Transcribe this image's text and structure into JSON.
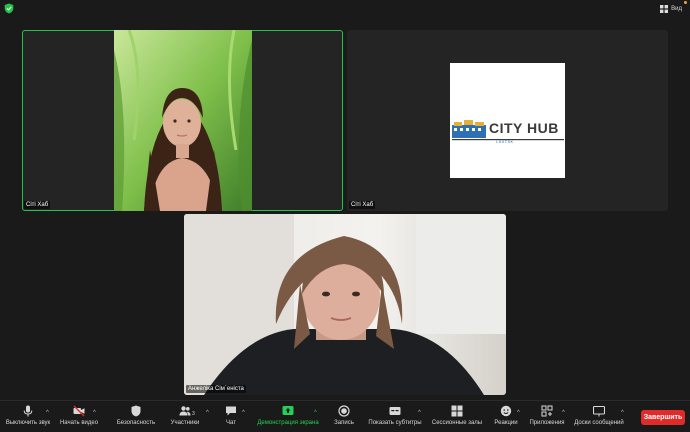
{
  "topbar": {
    "view_label": "Вид"
  },
  "participants": [
    {
      "name": "Сіті Хаб",
      "active": true
    },
    {
      "name": "Сіті Хаб",
      "active": false
    },
    {
      "name": "Анжеліка Сім`еніста",
      "active": false
    }
  ],
  "logo": {
    "word": "CITY HUB",
    "sub": "LOUTSK"
  },
  "toolbar": {
    "mute": "Выключить звук",
    "video": "Начать видео",
    "security": "Безопасность",
    "participants": "Участники",
    "participants_count": "3",
    "chat": "Чат",
    "share": "Демонстрация экрана",
    "record": "Запись",
    "captions": "Показать субтитры",
    "breakout": "Сессионные залы",
    "reactions": "Реакции",
    "apps": "Приложения",
    "whiteboard": "Доски сообщений",
    "end": "Завершить"
  },
  "colors": {
    "accent_green": "#26c24a",
    "end_red": "#e02b2b",
    "share_green": "#24d056"
  }
}
